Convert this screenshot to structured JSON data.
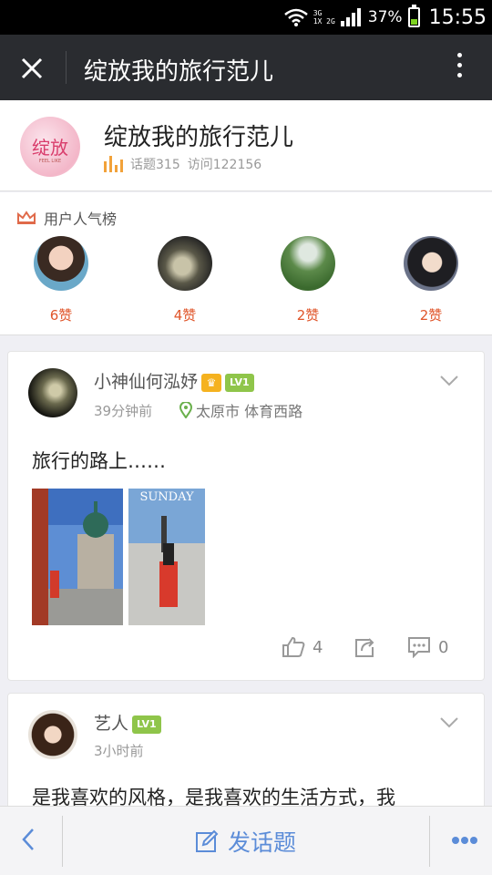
{
  "status_bar": {
    "network_top": "3G",
    "network_bottom": "1X 2G",
    "battery_pct": "37%",
    "time": "15:55"
  },
  "titlebar": {
    "title": "绽放我的旅行范儿",
    "close_icon": "close-icon",
    "more_icon": "more-vertical-icon"
  },
  "header": {
    "logo_text": "绽放",
    "logo_sub": "FEEL LIKE",
    "title": "绽放我的旅行范儿",
    "topics": "话题315",
    "visits": "访问122156"
  },
  "popular": {
    "heading": "用户人气榜",
    "users": [
      {
        "likes": "6赞"
      },
      {
        "likes": "4赞"
      },
      {
        "likes": "2赞"
      },
      {
        "likes": "2赞"
      }
    ]
  },
  "posts": [
    {
      "username": "小神仙何泓妤",
      "crown_badge": "♛",
      "level": "LV1",
      "time": "39分钟前",
      "location": "太原市 体育西路",
      "text": "旅行的路上……",
      "photo2_caption": "SUNDAY",
      "likes": "4",
      "comments": "0"
    },
    {
      "username": "艺人",
      "level": "LV1",
      "time": "3小时前",
      "text": "是我喜欢的风格，是我喜欢的生活方式，我"
    }
  ],
  "bottom_bar": {
    "post_label": "发话题"
  },
  "colors": {
    "titlebar_bg": "#2a2c30",
    "accent_blue": "#5b8cd8",
    "likes_red": "#e0552a",
    "level_green": "#8fc54a",
    "crown_gold": "#f5b21f"
  }
}
